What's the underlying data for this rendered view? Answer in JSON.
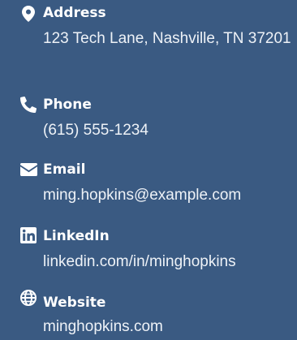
{
  "contacts": [
    {
      "label": "Address",
      "value": "123 Tech Lane, Nashville, TN 37201",
      "icon": "map-pin-icon"
    },
    {
      "label": "Phone",
      "value": "(615) 555-1234",
      "icon": "phone-icon"
    },
    {
      "label": "Email",
      "value": "ming.hopkins@example.com",
      "icon": "envelope-icon"
    },
    {
      "label": "LinkedIn",
      "value": "linkedin.com/in/minghopkins",
      "icon": "linkedin-icon"
    },
    {
      "label": "Website",
      "value": "minghopkins.com",
      "icon": "globe-icon"
    }
  ],
  "colors": {
    "background": "#3a5a82",
    "text": "#ffffff"
  }
}
